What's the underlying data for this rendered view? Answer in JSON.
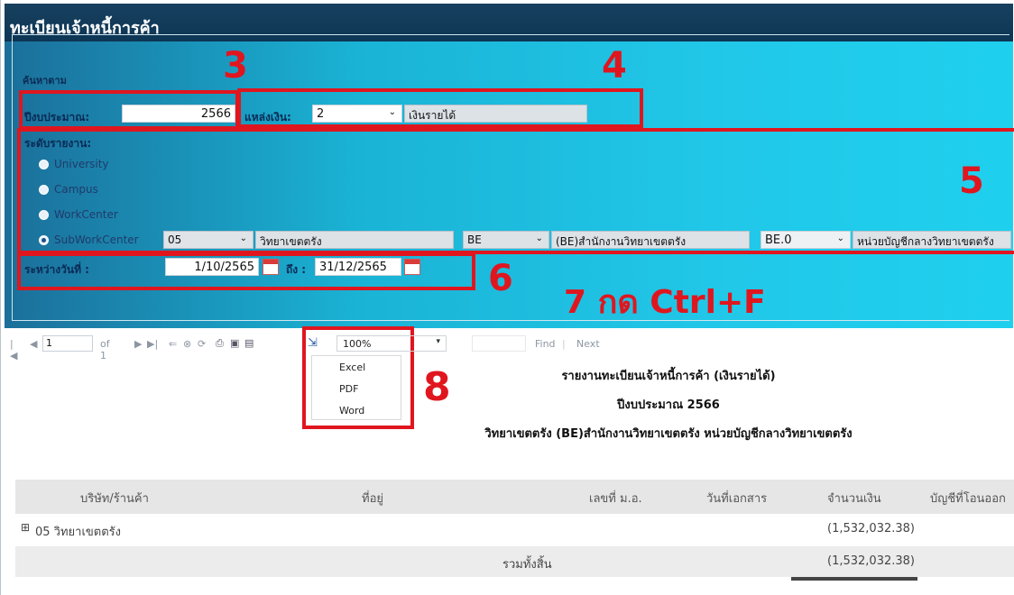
{
  "window": {
    "title": "ทะเบียนเจ้าหนี้การค้า"
  },
  "search": {
    "legend": "ค้นหาตาม",
    "budget_year_label": "ปีงบประมาณ:",
    "budget_year_value": "2566",
    "fund_source_label": "แหล่งเงิน:",
    "fund_source_code": "2",
    "fund_source_name": "เงินรายได้",
    "report_level_label": "ระดับรายงาน:",
    "levels": [
      "University",
      "Campus",
      "WorkCenter",
      "SubWorkCenter"
    ],
    "selected_level": "SubWorkCenter",
    "sub_code": "05",
    "sub_name": "วิทยาเขตตรัง",
    "be_code": "BE",
    "be_name": "(BE)สำนักงานวิทยาเขตตรัง",
    "be0_code": "BE.0",
    "be0_name": "หน่วยบัญชีกลางวิทยาเขตตรัง",
    "date_range_label": "ระหว่างวันที่ :",
    "date_from": "1/10/2565",
    "date_to_label": "ถึง :",
    "date_to": "31/12/2565"
  },
  "annotations": {
    "n3": "3",
    "n4": "4",
    "n5": "5",
    "n6": "6",
    "n7": "7 กด Ctrl+F",
    "n8": "8",
    "color": "#e0161f"
  },
  "toolbar": {
    "page": "1",
    "of_pages": "of 1",
    "zoom": "100%",
    "find": "Find",
    "sep": "|",
    "next": "Next",
    "export_options": [
      "Excel",
      "PDF",
      "Word"
    ]
  },
  "report": {
    "title": "รายงานทะเบียนเจ้าหนี้การค้า (เงินรายได้)",
    "subtitle": "ปีงบประมาณ 2566",
    "unit_line": "วิทยาเขตตรัง (BE)สำนักงานวิทยาเขตตรัง หน่วยบัญชีกลางวิทยาเขตตรัง",
    "columns": [
      "บริษัท/ร้านค้า",
      "ที่อยู่",
      "เลขที่ ม.อ.",
      "วันที่เอกสาร",
      "จำนวนเงิน",
      "บัญชีที่โอนออก"
    ],
    "rows": [
      {
        "expand": "⊞",
        "name": "05 วิทยาเขตตรัง",
        "amount": "(1,532,032.38)"
      }
    ],
    "total_label": "รวมทั้งสิ้น",
    "total_amount": "(1,532,032.38)"
  }
}
